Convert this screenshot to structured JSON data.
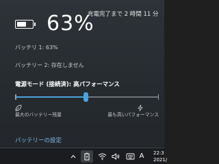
{
  "battery": {
    "percent_text": "63%",
    "level": 0.63,
    "charge_status": "充電完了まで 2 時間 11 分",
    "battery1": "バッテリ 1: 63%",
    "battery2": "バッテリー 2: 存在しません"
  },
  "power_mode": {
    "label": "電源モード (接続済): 高パフォーマンス",
    "slider_value": 0.49,
    "left_label": "最大のバッテリー残量",
    "right_label": "最も高いパフォーマンス",
    "left_icon": "leaf-icon",
    "right_icon": "bolt-icon"
  },
  "settings_link": "バッテリーの設定",
  "taskbar": {
    "icons": [
      "chevron-up-icon",
      "battery-charging-icon",
      "wifi-icon",
      "volume-icon",
      "ime-icon"
    ],
    "language": "A",
    "time": "22:3",
    "date": "2021/1"
  },
  "colors": {
    "accent": "#4aa3df",
    "link": "#7db9e8",
    "flyout_bg": "#2d3338",
    "taskbar_bg": "#1a1c1f"
  }
}
